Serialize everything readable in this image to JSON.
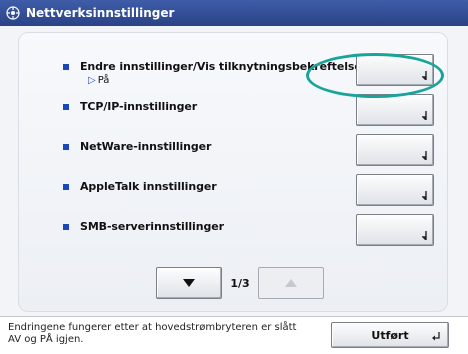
{
  "title": "Nettverksinnstillinger",
  "title_icon": "network-settings-icon",
  "rows": [
    {
      "label": "Endre innstillinger/Vis tilknytningsbekreftelse.",
      "sub_value": "På"
    },
    {
      "label": "TCP/IP-innstillinger"
    },
    {
      "label": "NetWare-innstillinger"
    },
    {
      "label": "AppleTalk innstillinger"
    },
    {
      "label": "SMB-serverinnstillinger"
    }
  ],
  "pager": {
    "indicator": "1/3"
  },
  "footer": {
    "message": "Endringene fungerer etter at hovedstrømbryteren er slått AV og PÅ igjen.",
    "done_label": "Utført"
  },
  "colors": {
    "titlebar": "#2b4286",
    "accent": "#1b48b8",
    "highlight": "#19a49b"
  }
}
